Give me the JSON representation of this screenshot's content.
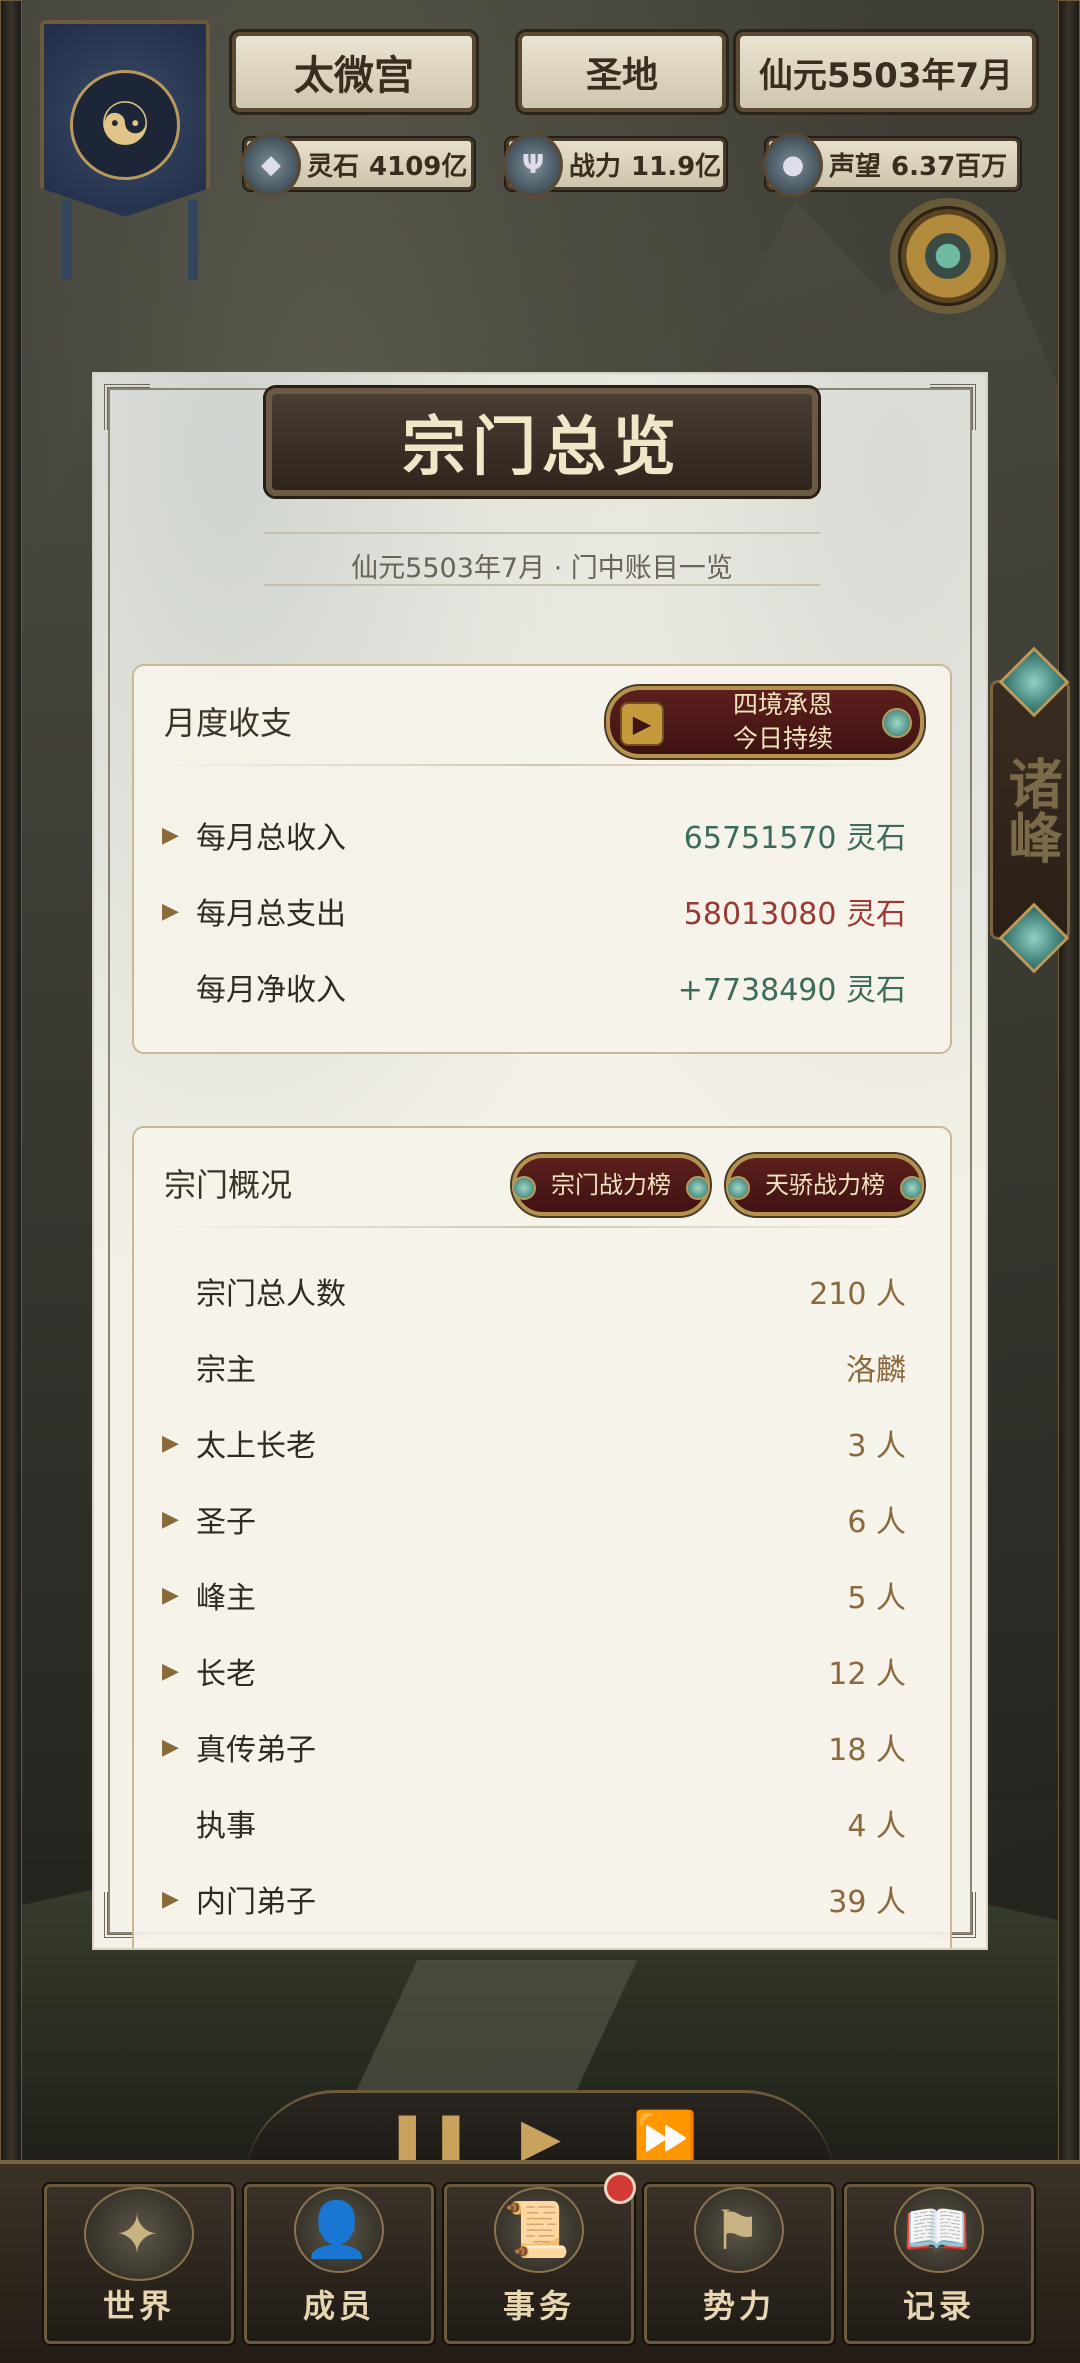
{
  "header": {
    "sect_name": "太微宫",
    "sect_tier": "圣地",
    "date": "仙元5503年7月",
    "stats": {
      "spirit_stone": {
        "label": "灵石",
        "value": "4109亿"
      },
      "power": {
        "label": "战力",
        "value": "11.9亿"
      },
      "reputation": {
        "label": "声望",
        "value": "6.37百万"
      }
    }
  },
  "side_tab": {
    "label": "诸峰"
  },
  "panel": {
    "title": "宗门总览",
    "subtitle": "仙元5503年7月 · 门中账目一览",
    "finance": {
      "heading": "月度收支",
      "grace_button": {
        "line1": "四境承恩",
        "line2": "今日持续"
      },
      "rows": [
        {
          "label": "每月总收入",
          "value": "65751570 灵石"
        },
        {
          "label": "每月总支出",
          "value": "58013080 灵石"
        },
        {
          "label": "每月净收入",
          "value": "+7738490 灵石"
        }
      ]
    },
    "overview": {
      "heading": "宗门概况",
      "rank_button_1": "宗门战力榜",
      "rank_button_2": "天骄战力榜",
      "rows": [
        {
          "label": "宗门总人数",
          "value": "210 人"
        },
        {
          "label": "宗主",
          "value": "洛麟"
        },
        {
          "label": "太上长老",
          "value": "3 人"
        },
        {
          "label": "圣子",
          "value": "6 人"
        },
        {
          "label": "峰主",
          "value": "5 人"
        },
        {
          "label": "长老",
          "value": "12 人"
        },
        {
          "label": "真传弟子",
          "value": "18 人"
        },
        {
          "label": "执事",
          "value": "4 人"
        },
        {
          "label": "内门弟子",
          "value": "39 人"
        }
      ]
    }
  },
  "nav": {
    "world": "世界",
    "members": "成员",
    "affairs": "事务",
    "power": "势力",
    "records": "记录"
  },
  "colors": {
    "income": "#3d6b5a",
    "expense": "#9b3a34",
    "count": "#8a6a3c"
  }
}
